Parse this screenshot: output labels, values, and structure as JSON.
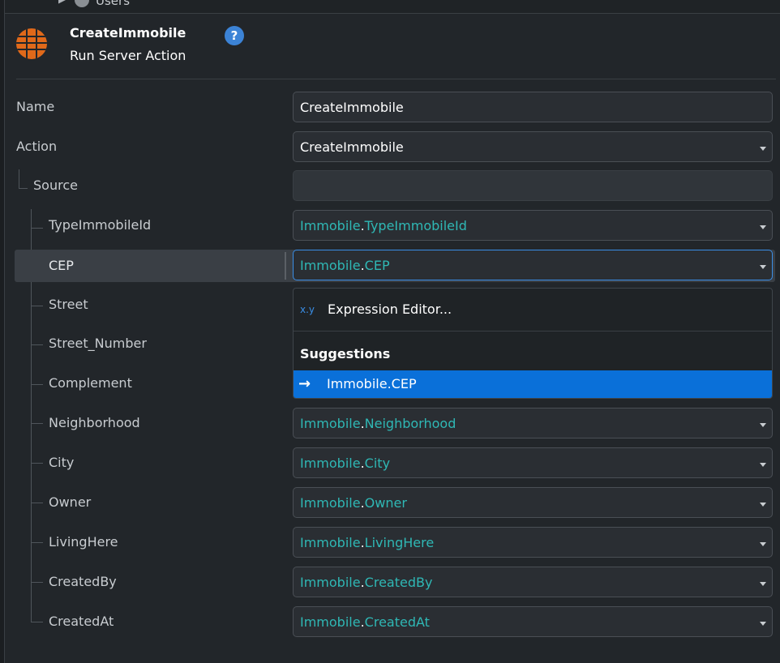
{
  "top": {
    "label": "Users"
  },
  "header": {
    "title": "CreateImmobile",
    "subtitle": "Run Server Action",
    "help_label": "?"
  },
  "rows": [
    {
      "label": "Name",
      "value": "CreateImmobile"
    },
    {
      "label": "Action",
      "value": "CreateImmobile"
    },
    {
      "label": "Source",
      "value": ""
    },
    {
      "label": "TypeImmobileId",
      "entity": "Immobile",
      "dot": ".",
      "attr": "TypeImmobileId"
    },
    {
      "label": "CEP",
      "entity": "Immobile",
      "dot": ".",
      "attr": "CEP"
    },
    {
      "label": "Street"
    },
    {
      "label": "Street_Number"
    },
    {
      "label": "Complement"
    },
    {
      "label": "Neighborhood",
      "entity": "Immobile",
      "dot": ".",
      "attr": "Neighborhood"
    },
    {
      "label": "City",
      "entity": "Immobile",
      "dot": ".",
      "attr": "City"
    },
    {
      "label": "Owner",
      "entity": "Immobile",
      "dot": ".",
      "attr": "Owner"
    },
    {
      "label": "LivingHere",
      "entity": "Immobile",
      "dot": ".",
      "attr": "LivingHere"
    },
    {
      "label": "CreatedBy",
      "entity": "Immobile",
      "dot": ".",
      "attr": "CreatedBy"
    },
    {
      "label": "CreatedAt",
      "entity": "Immobile",
      "dot": ".",
      "attr": "CreatedAt"
    }
  ],
  "dropdown": {
    "expr_prefix": "x.y",
    "expr_label": "Expression Editor...",
    "suggestions_header": "Suggestions",
    "suggestion": "Immobile.CEP",
    "suggestion_icon": "→"
  },
  "colors": {
    "background": "#22262a",
    "accent": "#0a70d9",
    "entity_text": "#2fb8b5",
    "logo": "#e0691a",
    "help": "#3c83d6"
  },
  "icons": {
    "header_logo": "server-action-icon",
    "help": "help-icon",
    "dropdown": "chevron-down-icon",
    "suggestion": "arrow-in-icon"
  }
}
